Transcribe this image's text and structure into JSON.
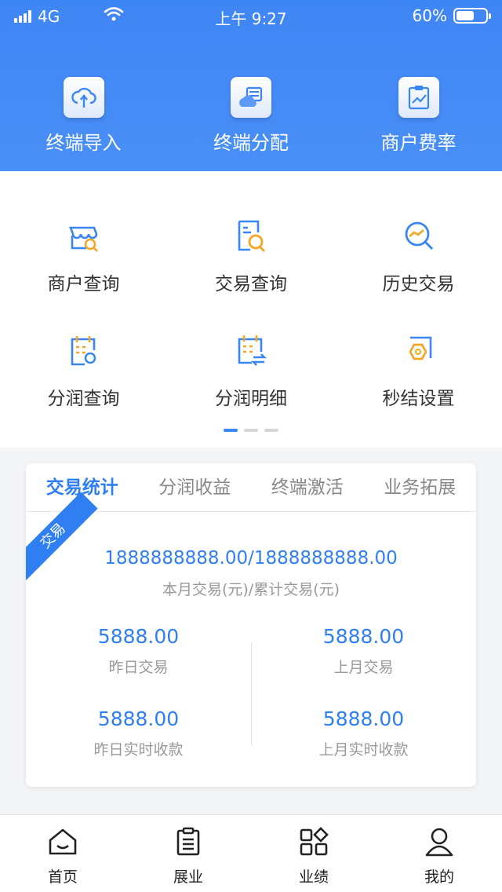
{
  "status_bar": {
    "network": "4G",
    "time": "上午 9:27",
    "battery": "60%",
    "battery_level": 0.6
  },
  "top_actions": [
    {
      "label": "终端导入",
      "icon": "cloud-import-icon"
    },
    {
      "label": "终端分配",
      "icon": "server-cloud-icon"
    },
    {
      "label": "商户费率",
      "icon": "clipboard-chart-icon"
    }
  ],
  "menu": [
    {
      "label": "商户查询",
      "icon": "store-search-icon"
    },
    {
      "label": "交易查询",
      "icon": "document-search-icon"
    },
    {
      "label": "历史交易",
      "icon": "trend-search-icon"
    },
    {
      "label": "分润查询",
      "icon": "calendar-search-icon"
    },
    {
      "label": "分润明细",
      "icon": "calendar-transfer-icon"
    },
    {
      "label": "秒结设置",
      "icon": "hexagon-settings-icon"
    }
  ],
  "pager": {
    "pages": 3,
    "active": 0
  },
  "stats": {
    "tabs": [
      "交易统计",
      "分润收益",
      "终端激活",
      "业务拓展"
    ],
    "active_tab": 0,
    "ribbon": "交易",
    "total_value": "1888888888.00/1888888888.00",
    "total_label": "本月交易(元)/累计交易(元)",
    "items": [
      {
        "value": "5888.00",
        "label": "昨日交易"
      },
      {
        "value": "5888.00",
        "label": "上月交易"
      },
      {
        "value": "5888.00",
        "label": "昨日实时收款"
      },
      {
        "value": "5888.00",
        "label": "上月实时收款"
      }
    ]
  },
  "bottom_nav": [
    {
      "label": "首页",
      "icon": "home-icon"
    },
    {
      "label": "展业",
      "icon": "clipboard-icon"
    },
    {
      "label": "业绩",
      "icon": "grid-apps-icon"
    },
    {
      "label": "我的",
      "icon": "user-icon"
    }
  ],
  "colors": {
    "primary": "#2f7ff3",
    "header": "#4a8ff7",
    "accent_orange": "#f5a623"
  }
}
